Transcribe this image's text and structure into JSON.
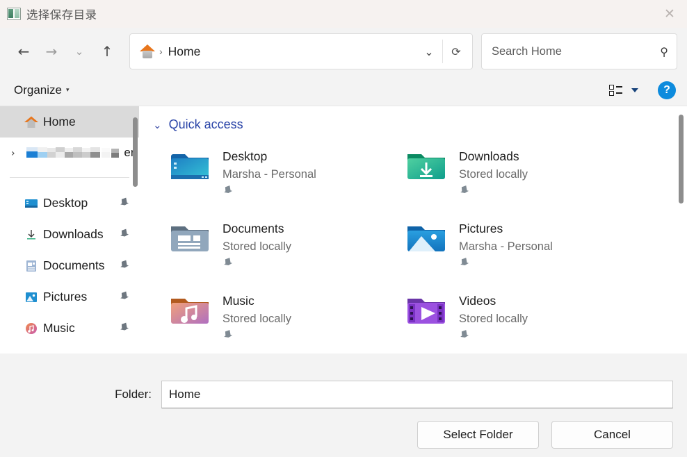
{
  "window": {
    "title": "选择保存目录",
    "icon": "app-window-icon",
    "close_label": "✕"
  },
  "nav": {
    "back": "←",
    "forward": "→",
    "recent": "⌄",
    "up": "↑",
    "address": {
      "home_icon": "home-icon",
      "separator": "›",
      "path_label": "Home",
      "dropdown": "⌄",
      "refresh": "⟳"
    },
    "search": {
      "value": "",
      "placeholder": "Search Home",
      "icon": "⚲"
    }
  },
  "commandbar": {
    "organize_label": "Organize",
    "organize_caret": "▾",
    "view_icon": "details-view-icon",
    "view_caret": "▾",
    "help_label": "?"
  },
  "sidebar": {
    "items": [
      {
        "label": "Home",
        "icon": "home-icon",
        "selected": true,
        "pinned": false
      },
      {
        "label": "ers",
        "icon": "onedrive-icon",
        "redacted": true,
        "expandable": true,
        "chevron": "›"
      },
      {
        "label": "Desktop",
        "icon": "desktop-icon",
        "pinned": true
      },
      {
        "label": "Downloads",
        "icon": "downloads-icon",
        "pinned": true
      },
      {
        "label": "Documents",
        "icon": "documents-icon",
        "pinned": true
      },
      {
        "label": "Pictures",
        "icon": "pictures-icon",
        "pinned": true
      },
      {
        "label": "Music",
        "icon": "music-icon",
        "pinned": true
      }
    ],
    "pin_glyph": "📌"
  },
  "content": {
    "section": {
      "chevron": "⌄",
      "title": "Quick access"
    },
    "tiles": [
      {
        "name": "Desktop",
        "sub": "Marsha - Personal",
        "icon": "desktop-folder-icon",
        "pinned": true
      },
      {
        "name": "Downloads",
        "sub": "Stored locally",
        "icon": "downloads-folder-icon",
        "pinned": true
      },
      {
        "name": "Documents",
        "sub": "Stored locally",
        "icon": "documents-folder-icon",
        "pinned": true
      },
      {
        "name": "Pictures",
        "sub": "Marsha - Personal",
        "icon": "pictures-folder-icon",
        "pinned": true
      },
      {
        "name": "Music",
        "sub": "Stored locally",
        "icon": "music-folder-icon",
        "pinned": true
      },
      {
        "name": "Videos",
        "sub": "Stored locally",
        "icon": "videos-folder-icon",
        "pinned": true
      }
    ],
    "pin_glyph": "📌"
  },
  "footer": {
    "folder_label": "Folder:",
    "folder_value": "Home",
    "folder_placeholder": "",
    "select_button": "Select Folder",
    "cancel_button": "Cancel"
  },
  "colors": {
    "accent_blue": "#0d8bdd",
    "quick_access_blue": "#2b45a8",
    "home_orange": "#e8761c",
    "selection_gray": "#dadada"
  }
}
